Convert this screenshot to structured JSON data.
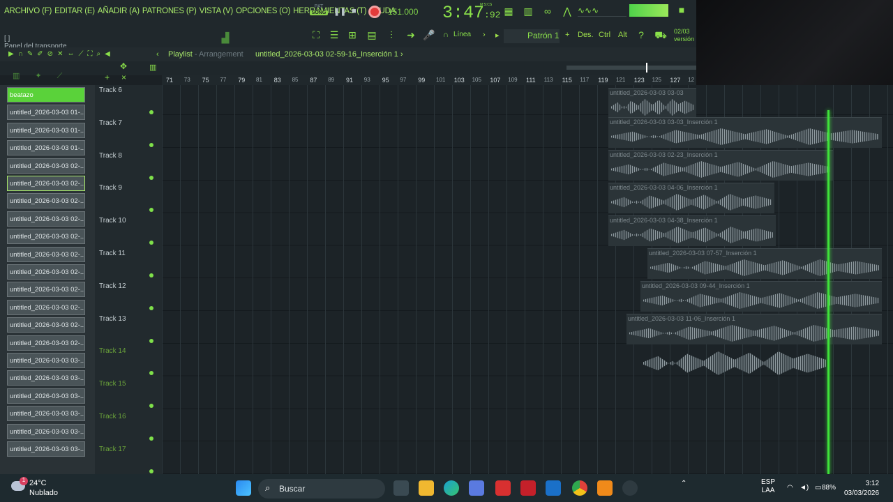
{
  "menu": [
    "ARCHIVO (F)",
    "EDITAR (E)",
    "AÑADIR (A)",
    "PATRONES (P)",
    "VISTA (V)",
    "OPCIONES (O)",
    "HERRAMIENTAS (T)",
    "AYUDA"
  ],
  "transport": {
    "pat": "PAT",
    "song": "SONG",
    "tempo": "151.000",
    "time_main": "3:47",
    "time_frac": ":92",
    "time_unit": "M:S:CS",
    "panel": "Panel del transporte",
    "bracket": "[ ]"
  },
  "toolbar": {
    "linea": "Línea",
    "patron": "Patrón 1",
    "plus": "+",
    "des": "Des.",
    "ctrl": "Ctrl",
    "alt": "Alt",
    "version_date": "02/03",
    "version_label": "versión"
  },
  "playlist": {
    "title": "Playlist",
    "arrow": "-",
    "arrangement": "Arrangement",
    "name": "untitled_2026-03-03 02-59-16_Inserción 1",
    "name_arrow": "›"
  },
  "ruler": [
    "71",
    "73",
    "75",
    "77",
    "79",
    "81",
    "83",
    "85",
    "87",
    "89",
    "91",
    "93",
    "95",
    "97",
    "99",
    "101",
    "103",
    "105",
    "107",
    "109",
    "111",
    "113",
    "115",
    "117",
    "119",
    "121",
    "123",
    "125",
    "127",
    "12"
  ],
  "browser": [
    "beatazo",
    "untitled_2026-03-03 01-...",
    "untitled_2026-03-03 01-...",
    "untitled_2026-03-03 01-...",
    "untitled_2026-03-03 02-...",
    "untitled_2026-03-03 02-...",
    "untitled_2026-03-03 02-...",
    "untitled_2026-03-03 02-...",
    "untitled_2026-03-03 02-...",
    "untitled_2026-03-03 02-...",
    "untitled_2026-03-03 02-...",
    "untitled_2026-03-03 02-...",
    "untitled_2026-03-03 02-...",
    "untitled_2026-03-03 02-...",
    "untitled_2026-03-03 02-...",
    "untitled_2026-03-03 03-...",
    "untitled_2026-03-03 03-...",
    "untitled_2026-03-03 03-...",
    "untitled_2026-03-03 03-...",
    "untitled_2026-03-03 03-...",
    "untitled_2026-03-03 03-..."
  ],
  "tracks": [
    "Track 6",
    "Track 7",
    "Track 8",
    "Track 9",
    "Track 10",
    "Track 11",
    "Track 12",
    "Track 13",
    "Track 14",
    "Track 15",
    "Track 16",
    "Track 17"
  ],
  "clips": [
    "untitled_2026-03-03 03-03",
    "untitled_2026-03-03 03-03_Inserción 1",
    "untitled_2026-03-03 02-23_Inserción 1",
    "untitled_2026-03-03 04-06_Inserción 1",
    "untitled_2026-03-03 04-38_Inserción 1",
    "untitled_2026-03-03 07-57_Inserción 1",
    "untitled_2026-03-03 09-44_Inserción 1",
    "untitled_2026-03-03 11-06_Inserción 1"
  ],
  "taskbar": {
    "temp": "24°C",
    "cond": "Nublado",
    "badge": "1",
    "search": "Buscar",
    "lang1": "ESP",
    "lang2": "LAA",
    "battery": "88%",
    "time": "3:12",
    "date": "03/03/2026"
  },
  "colors": {
    "accent": "#8ae04a",
    "playhead": "#3fe23a",
    "record": "#e33b3b"
  }
}
